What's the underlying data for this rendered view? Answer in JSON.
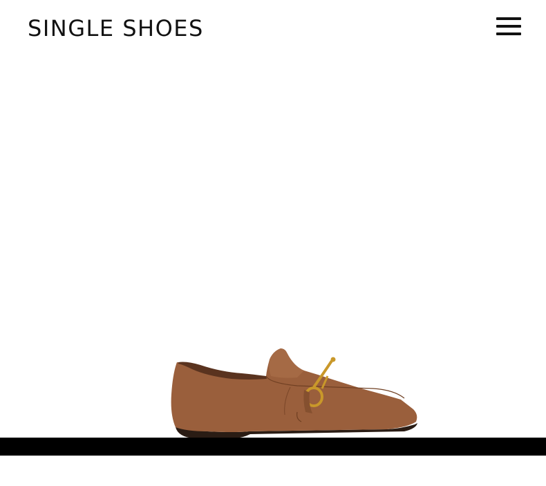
{
  "header": {
    "logo_text": "SINGLE SHOES",
    "menu_icon": "hamburger-menu-icon"
  },
  "hero": {
    "product_image": "brown-leather-horsebit-loafer",
    "colors": {
      "leather": "#9a5f3c",
      "hardware": "#c9982a",
      "sole": "#2a1c14"
    }
  },
  "slider": {
    "bar_color": "#000000"
  }
}
